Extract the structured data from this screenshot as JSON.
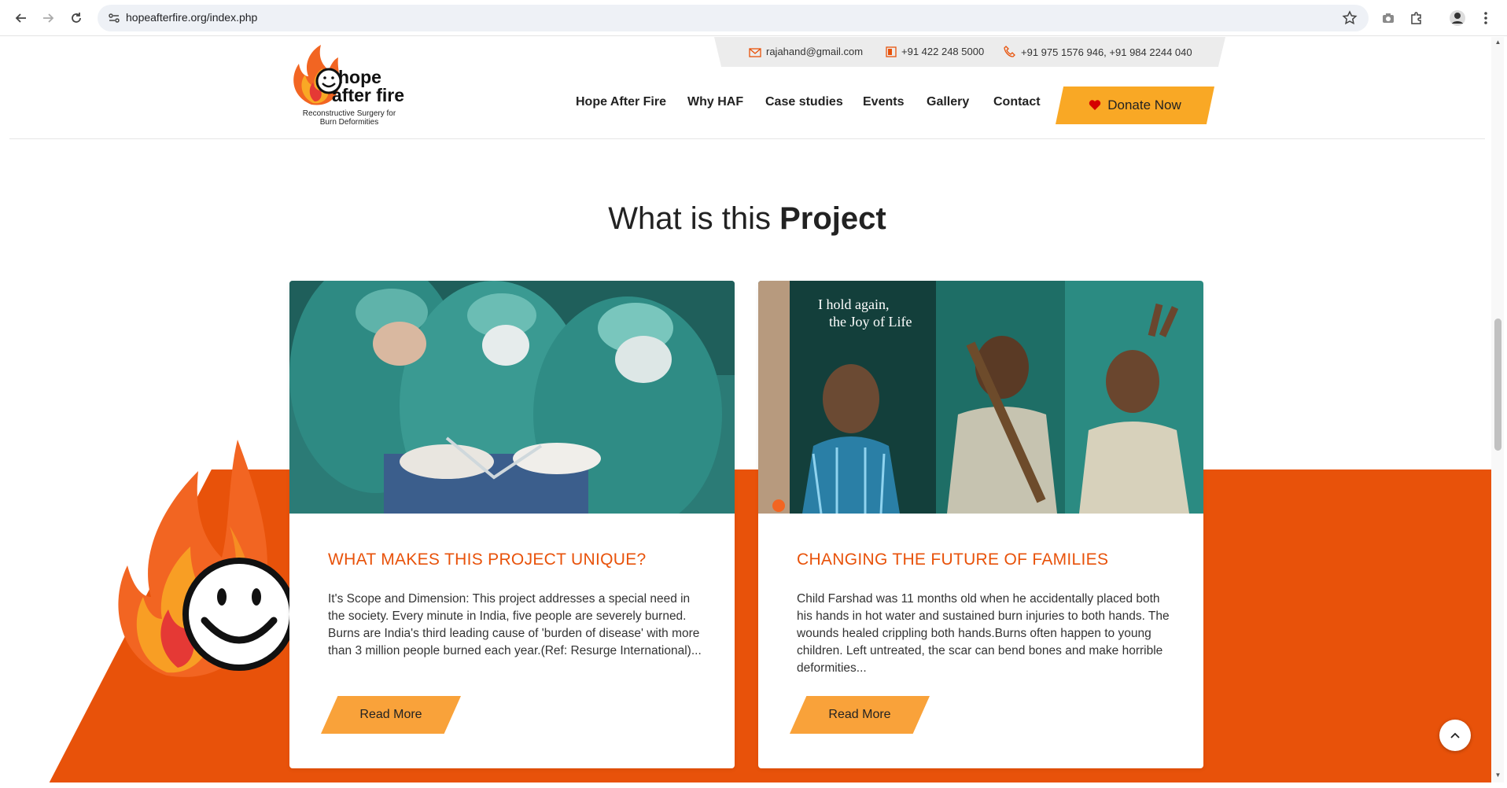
{
  "browser": {
    "url": "hopeafterfire.org/index.php"
  },
  "contact": {
    "email": "rajahand@gmail.com",
    "landline": "+91 422 248 5000",
    "mobile": "+91 975 1576 946, +91 984 2244 040"
  },
  "logo": {
    "line1": "hope",
    "line2": "after fire",
    "tagline": "Reconstructive Surgery for Burn Deformities"
  },
  "nav": {
    "items": [
      "Hope After Fire",
      "Why HAF",
      "Case studies",
      "Events",
      "Gallery",
      "Contact"
    ],
    "donate_label": "Donate Now"
  },
  "section": {
    "title_light": "What is this ",
    "title_bold": "Project"
  },
  "cards": [
    {
      "title": "WHAT MAKES THIS PROJECT UNIQUE?",
      "text": "It's Scope and Dimension: This project addresses a special need in the society. Every minute in India, five people are severely burned. Burns are India's third leading cause of 'burden of disease' with more than 3 million people burned each year.(Ref: Resurge International)...",
      "button": "Read More"
    },
    {
      "title": "CHANGING THE FUTURE OF FAMILIES",
      "text": "Child Farshad was 11 months old when he accidentally placed both his hands in hot water and sustained burn injuries to both hands. The wounds healed crippling both hands.Burns often happen to young children. Left untreated, the scar can bend bones and make horrible deformities...",
      "button": "Read More",
      "image_caption_line1": "I hold again,",
      "image_caption_line2": "the Joy of Life"
    }
  ],
  "colors": {
    "accent_orange": "#e8520a",
    "button_yellow": "#f9a825"
  }
}
